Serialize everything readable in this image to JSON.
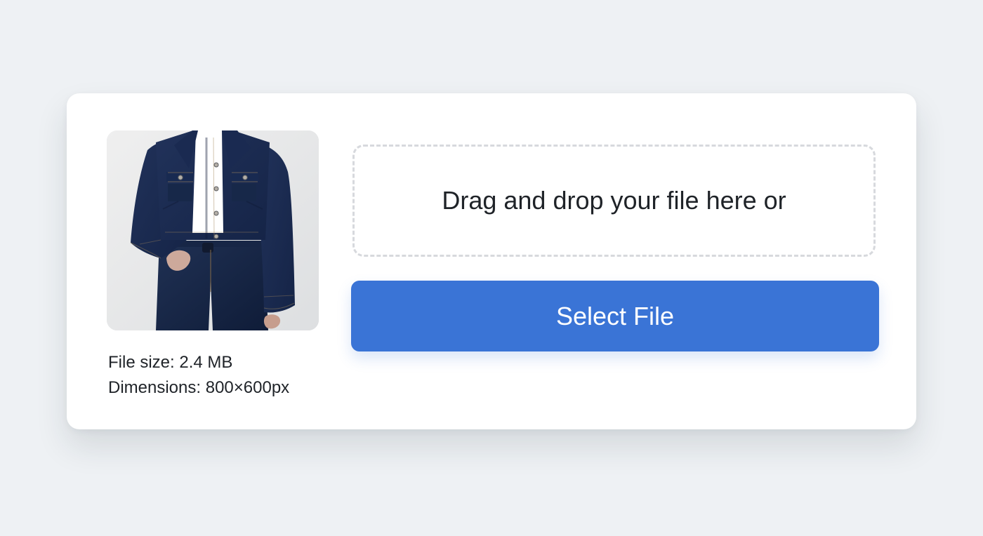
{
  "upload": {
    "drop_text": "Drag and drop your file here or",
    "select_label": "Select File",
    "accent_color": "#3A74D6"
  },
  "preview": {
    "image_icon": "denim-jacket-photo"
  },
  "file_info": {
    "size": "File size: 2.4 MB",
    "dimensions": "Dimensions: 800×600px"
  }
}
